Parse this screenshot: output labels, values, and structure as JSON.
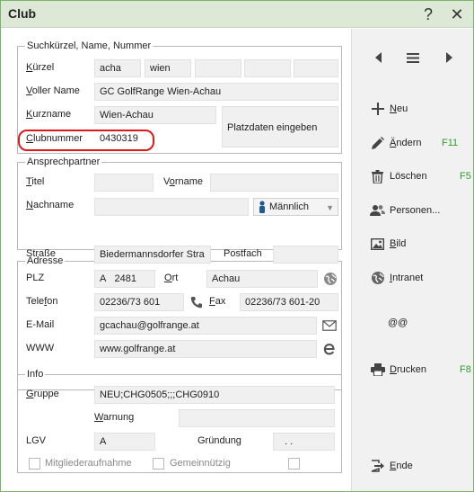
{
  "window": {
    "title": "Club",
    "help": "?",
    "close": "✕"
  },
  "section_id": {
    "legend": "Suchkürzel, Name, Nummer",
    "kuerzel_label_u": "K",
    "kuerzel_label_rest": "ürzel",
    "kuerzel_values": [
      "acha",
      "wien",
      "",
      "",
      ""
    ],
    "vollername_label_u": "V",
    "vollername_label_rest": "oller Name",
    "vollername_value": "GC GolfRange Wien-Achau",
    "kurzname_label_u": "K",
    "kurzname_label_rest": "urzname",
    "kurzname_value": "Wien-Achau",
    "clubnummer_label_u": "C",
    "clubnummer_label_rest": "lubnummer",
    "clubnummer_value": "0430319",
    "platzdaten_button": "Platzdaten eingeben"
  },
  "section_contact": {
    "legend": "Ansprechpartner",
    "titel_label_u": "T",
    "titel_label_rest": "itel",
    "titel_value": "",
    "vorname_label_pre": "V",
    "vorname_label_u": "o",
    "vorname_label_rest": "rname",
    "vorname_value": "",
    "nachname_label_pre": "",
    "nachname_label_u": "N",
    "nachname_label_rest": "achname",
    "nachname_value": "",
    "gender_value": "Männlich"
  },
  "section_address": {
    "legend": "Adresse",
    "strasse_label": "Straße",
    "strasse_value": "Biedermannsdorfer Stra",
    "postfach_label": "Postfach",
    "postfach_value": "",
    "plz_label": "PLZ",
    "plz_country": "A",
    "plz_value": "2481",
    "ort_label_u": "O",
    "ort_label_rest": "rt",
    "ort_value": "Achau",
    "telefon_label_pre": "Tele",
    "telefon_label_u": "f",
    "telefon_label_rest": "on",
    "telefon_value": "02236/73 601",
    "fax_label_u": "F",
    "fax_label_rest": "ax",
    "fax_value": "02236/73 601-20",
    "email_label": "E-Mail",
    "email_value": "gcachau@golfrange.at",
    "www_label": "WWW",
    "www_value": "www.golfrange.at"
  },
  "section_info": {
    "legend": "Info",
    "gruppe_label_u": "G",
    "gruppe_label_rest": "ruppe",
    "gruppe_value": "NEU;CHG0505;;;CHG0910",
    "warnung_label_u": "W",
    "warnung_label_rest": "arnung",
    "warnung_value": "",
    "lgv_label": "LGV",
    "lgv_value": "A",
    "gruendung_label": "Gründung",
    "gruendung_value": ". .",
    "check_mitglieder": "Mitgliederaufnahme",
    "check_gemeinnuetzig": "Gemeinnützig"
  },
  "sidebar": {
    "neu_u": "N",
    "neu_rest": "eu",
    "aendern_u": "Ä",
    "aendern_rest": "ndern",
    "aendern_key": "F11",
    "loeschen": "Löschen",
    "loeschen_key": "F5",
    "personen": "Personen...",
    "bild_u": "B",
    "bild_rest": "ild",
    "intranet_u": "I",
    "intranet_rest": "ntranet",
    "atat": "@@",
    "drucken_u": "D",
    "drucken_rest": "rucken",
    "drucken_key": "F8",
    "ende_u": "E",
    "ende_rest": "nde"
  },
  "colors": {
    "highlight": "#e01818",
    "shortcut": "#2e9d2e",
    "titlebar": "#dde8d6"
  }
}
